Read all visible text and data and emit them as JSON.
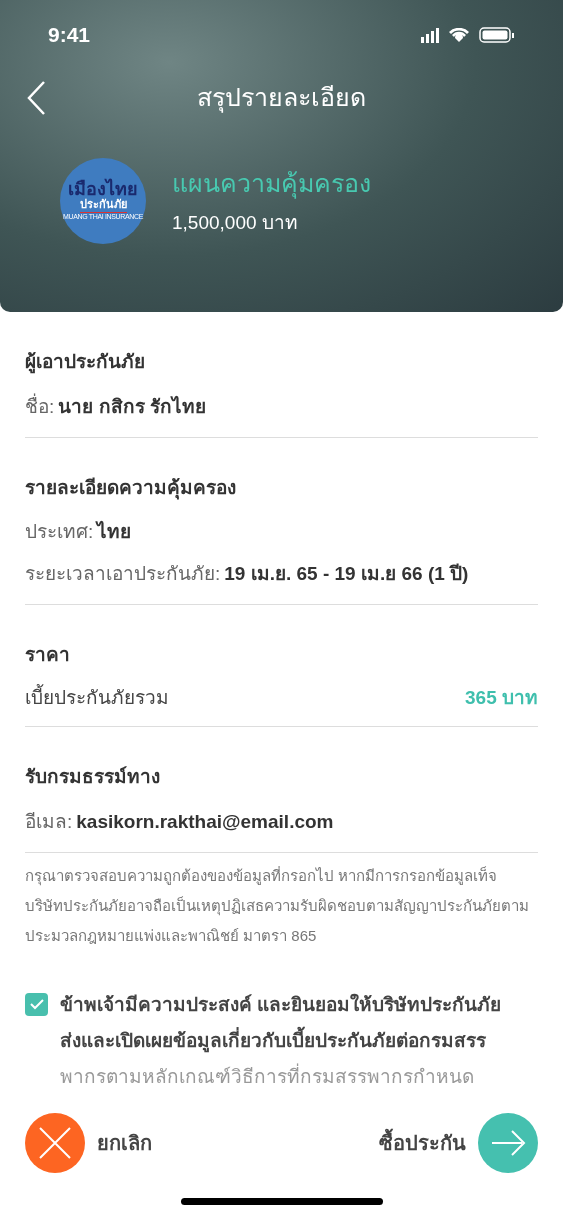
{
  "status_bar": {
    "time": "9:41"
  },
  "header": {
    "title": "สรุปรายละเอียด"
  },
  "plan": {
    "logo": {
      "line_1": "เมืองไทย",
      "line_2": "ประกันภัย",
      "line_3": "MUANG THAI INSURANCE"
    },
    "name": "แผนความคุ้มครอง",
    "coverage": "1,500,000 บาท"
  },
  "sections": [
    {
      "title": "ผู้เอาประกันภัย",
      "rows": [
        {
          "kind": "inline",
          "label": "ชื่อ:",
          "value": "นาย กสิกร รักไทย"
        }
      ]
    },
    {
      "title": "รายละเอียดความคุ้มครอง",
      "rows": [
        {
          "kind": "inline",
          "label": "ประเทศ:",
          "value": "ไทย"
        },
        {
          "kind": "inline",
          "label": "ระยะเวลาเอาประกันภัย:",
          "value": "19 เม.ย. 65 - 19 เม.ย 66 (1 ปี)"
        }
      ]
    },
    {
      "title": "ราคา",
      "rows": [
        {
          "kind": "split",
          "label": "เบี้ยประกันภัยรวม",
          "value": "365 บาท"
        }
      ]
    },
    {
      "title": "รับกรมธรรม์ทาง",
      "rows": [
        {
          "kind": "inline",
          "label": "อีเมล:",
          "value": "kasikorn.rakthai@email.com"
        }
      ]
    }
  ],
  "disclaimer": "กรุณาตรวจสอบความถูกต้องของข้อมูลที่กรอกไป หากมีการกรอกข้อมูลเท็จ บริษัทประกันภัยอาจถือเป็นเหตุปฏิเสธความรับผิดชอบตามสัญญาประกันภัยตามประมวลกฎหมายแพ่งและพาณิชย์ มาตรา 865",
  "consent": {
    "checked": true,
    "lines": [
      "ข้าพเจ้ามีความประสงค์ และยินยอมให้บริษัทประกันภัย",
      "ส่งและเปิดเผยข้อมูลเกี่ยวกับเบี้ยประกันภัยต่อกรมสรร",
      "พากรตามหลักเกณฑ์วิธีการที่กรมสรรพากรกำหนด"
    ]
  },
  "actions": {
    "cancel": "ยกเลิก",
    "buy": "ซื้อประกัน"
  }
}
